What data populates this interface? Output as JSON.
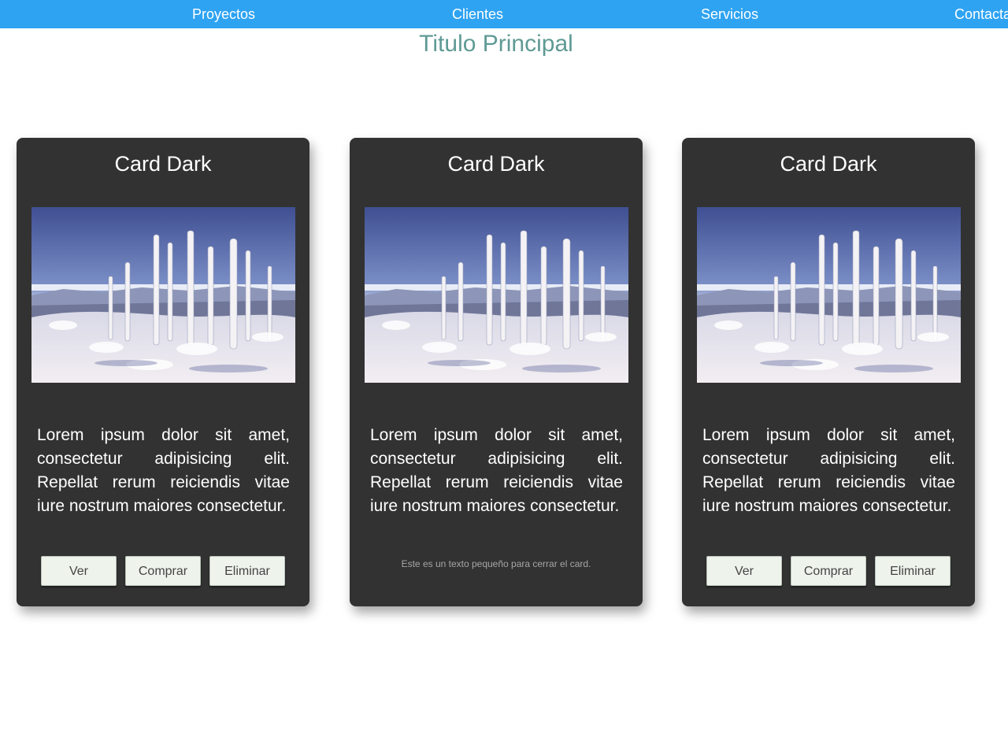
{
  "nav": {
    "items": [
      {
        "label": "Proyectos"
      },
      {
        "label": "Clientes"
      },
      {
        "label": "Servicios"
      },
      {
        "label": "Contacta"
      }
    ]
  },
  "page": {
    "title": "Titulo Principal"
  },
  "cards": [
    {
      "title": "Card Dark",
      "image": "snowy-frozen-trees-landscape",
      "text": "Lorem ipsum dolor sit amet, consectetur adipisicing elit. Repellat rerum reiciendis vitae iure nostrum maiores consectetur.",
      "buttons": {
        "view": "Ver",
        "buy": "Comprar",
        "delete": "Eliminar"
      }
    },
    {
      "title": "Card Dark",
      "image": "snowy-frozen-trees-landscape",
      "text": "Lorem ipsum dolor sit amet, consectetur adipisicing elit. Repellat rerum reiciendis vitae iure nostrum maiores consectetur.",
      "small_text": "Este es un texto pequeño para cerrar el card."
    },
    {
      "title": "Card Dark",
      "image": "snowy-frozen-trees-landscape",
      "text": "Lorem ipsum dolor sit amet, consectetur adipisicing elit. Repellat rerum reiciendis vitae iure nostrum maiores consectetur.",
      "buttons": {
        "view": "Ver",
        "buy": "Comprar",
        "delete": "Eliminar"
      }
    }
  ],
  "colors": {
    "nav_bg": "#2ea3f2",
    "title": "#5f9a94",
    "card_bg": "#323232",
    "button_bg": "#eef3ec"
  }
}
